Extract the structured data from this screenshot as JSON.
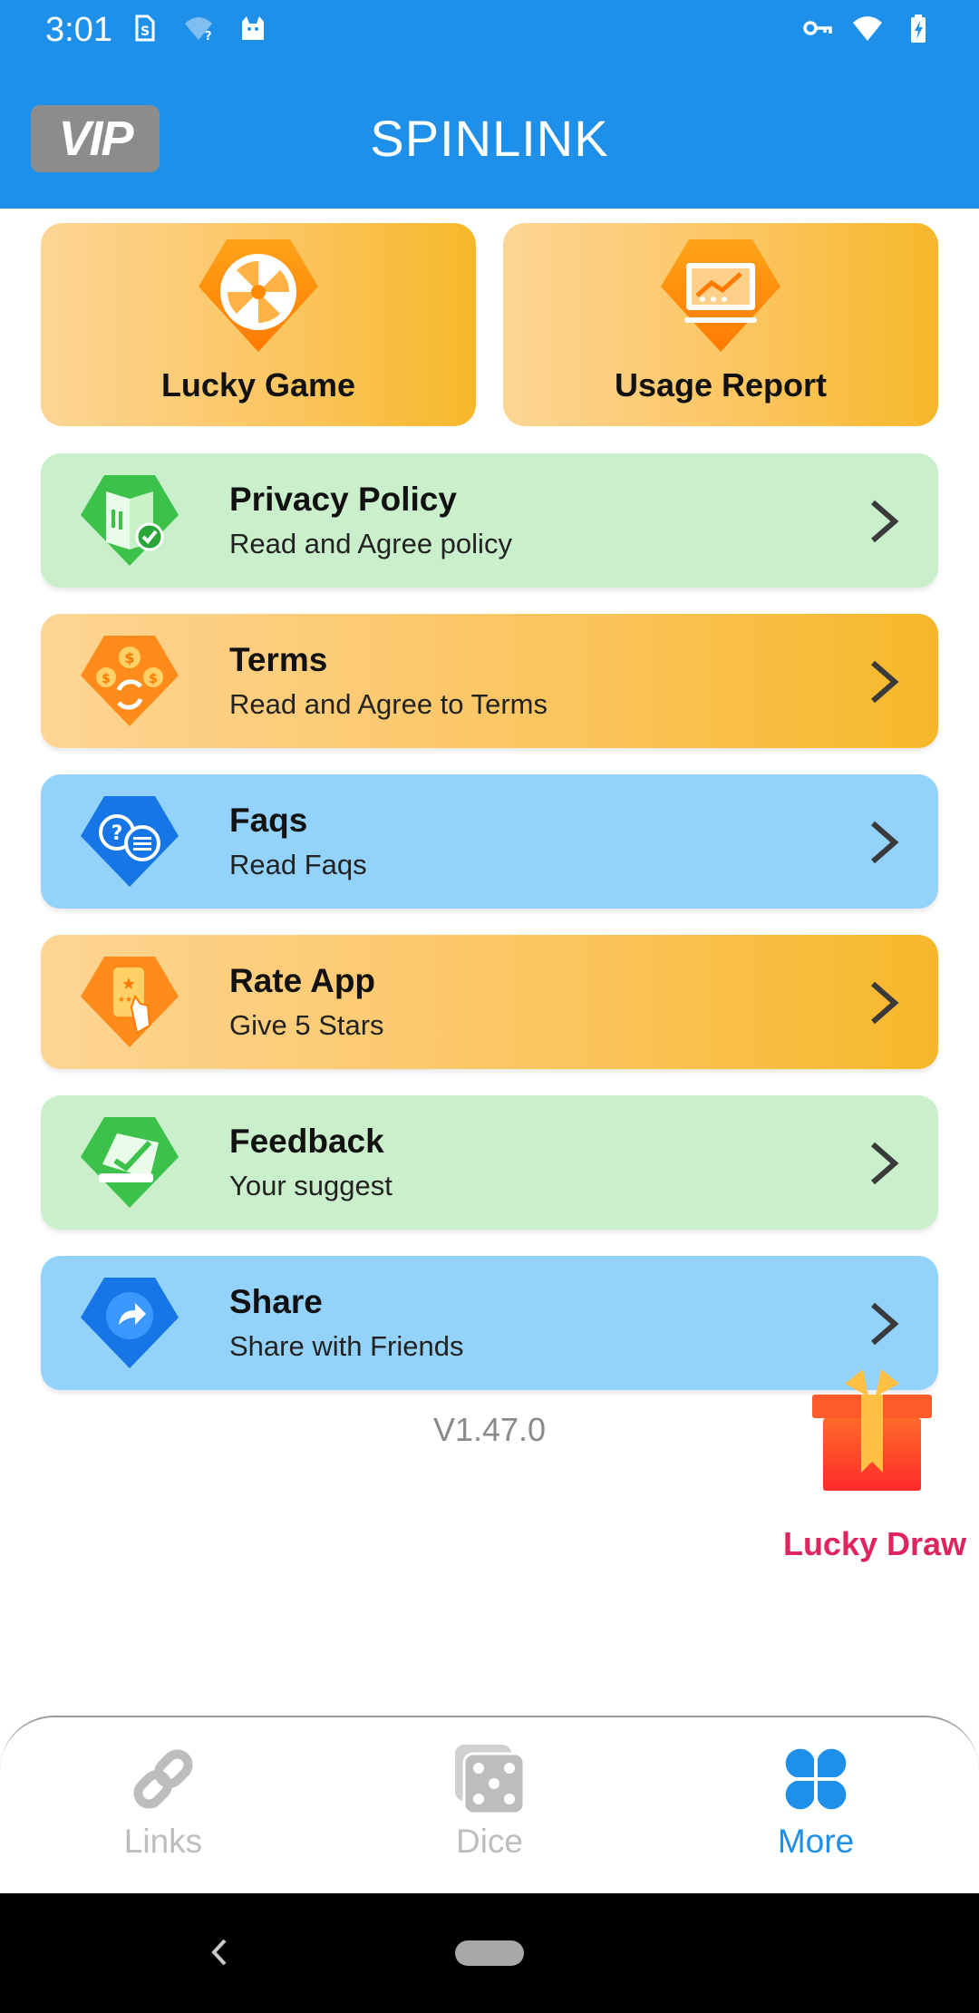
{
  "status_bar": {
    "time": "3:01",
    "left_icons": [
      "sim-card-icon",
      "wifi-question-icon",
      "cat-icon"
    ],
    "right_icons": [
      "vpn-key-icon",
      "wifi-icon",
      "battery-charging-icon"
    ]
  },
  "app_bar": {
    "vip_label": "VIP",
    "title": "SPINLINK"
  },
  "top_cards": [
    {
      "label": "Lucky Game",
      "icon": "wheel-icon"
    },
    {
      "label": "Usage Report",
      "icon": "report-chart-icon"
    }
  ],
  "menu": [
    {
      "title": "Privacy Policy",
      "subtitle": "Read and Agree policy",
      "icon": "privacy-book-icon",
      "color": "#c9f0cb"
    },
    {
      "title": "Terms",
      "subtitle": "Read and Agree to Terms",
      "icon": "terms-exchange-icon",
      "color": "#fbc45c"
    },
    {
      "title": "Faqs",
      "subtitle": "Read Faqs",
      "icon": "faq-chat-icon",
      "color": "#93d3fb"
    },
    {
      "title": "Rate App",
      "subtitle": "Give 5 Stars",
      "icon": "rate-phone-icon",
      "color": "#fbc45c"
    },
    {
      "title": "Feedback",
      "subtitle": "Your suggest",
      "icon": "feedback-check-icon",
      "color": "#c9f0cb"
    },
    {
      "title": "Share",
      "subtitle": "Share with Friends",
      "icon": "share-arrow-icon",
      "color": "#93d3fb"
    }
  ],
  "version": "V1.47.0",
  "lucky_draw": {
    "label": "Lucky Draw",
    "icon": "gift-box-icon"
  },
  "bottom_nav": {
    "items": [
      {
        "label": "Links",
        "icon": "link-icon",
        "active": false
      },
      {
        "label": "Dice",
        "icon": "dice-icon",
        "active": false
      },
      {
        "label": "More",
        "icon": "grid-more-icon",
        "active": true
      }
    ],
    "active_color": "#1e90ea",
    "inactive_color": "#bdbdbd"
  },
  "colors": {
    "primary": "#1e90ea",
    "accent_pink": "#e0245e"
  }
}
